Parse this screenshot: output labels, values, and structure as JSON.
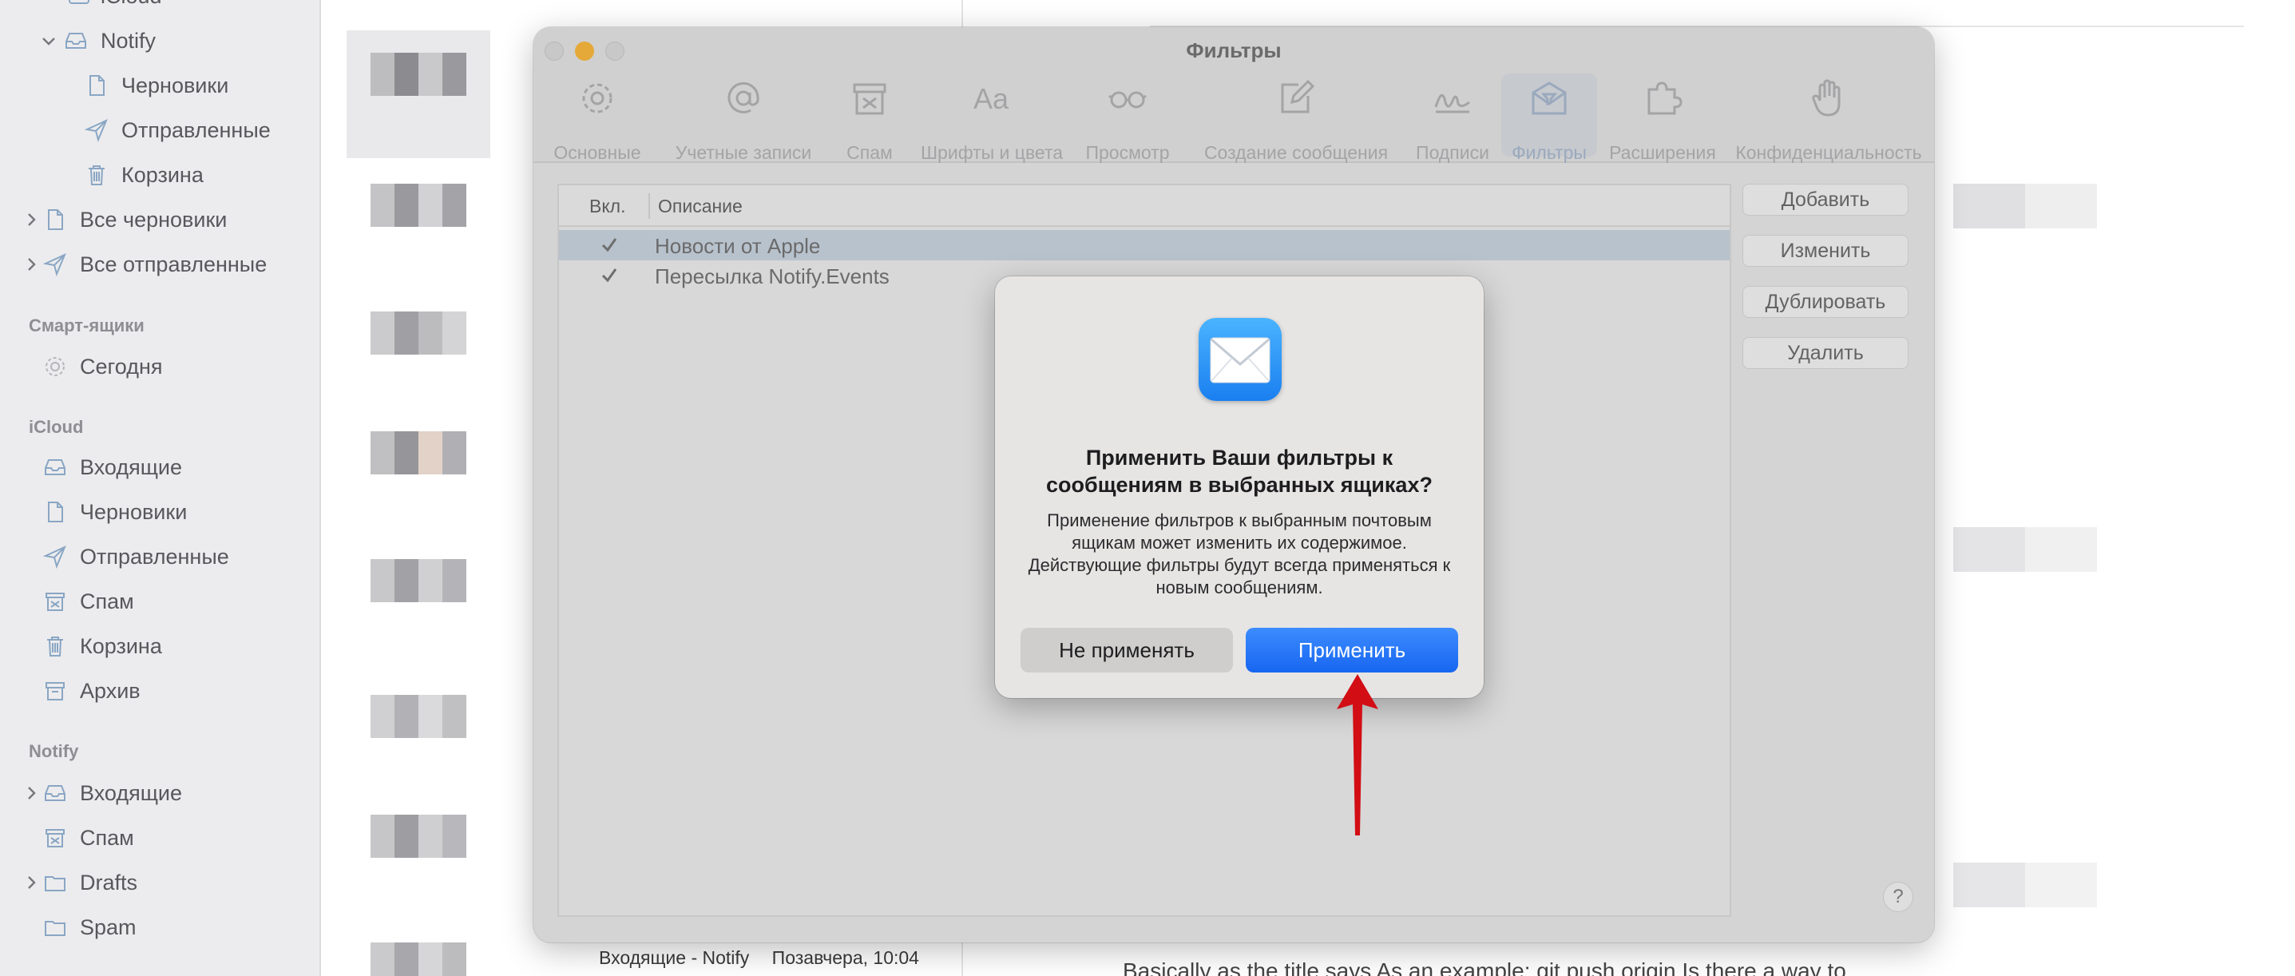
{
  "sidebar": {
    "top_item": {
      "label": "iCloud"
    },
    "notify_account": {
      "label": "Notify"
    },
    "notify_children": [
      {
        "label": "Черновики",
        "icon": "draft-icon"
      },
      {
        "label": "Отправленные",
        "icon": "sent-icon"
      },
      {
        "label": "Корзина",
        "icon": "trash-icon"
      }
    ],
    "all_drafts": {
      "label": "Все черновики"
    },
    "all_sent": {
      "label": "Все отправленные"
    },
    "smart_header": "Смарт-ящики",
    "today": {
      "label": "Сегодня"
    },
    "icloud_header": "iCloud",
    "icloud_items": [
      {
        "label": "Входящие",
        "icon": "inbox-icon"
      },
      {
        "label": "Черновики",
        "icon": "draft-icon"
      },
      {
        "label": "Отправленные",
        "icon": "sent-icon"
      },
      {
        "label": "Спам",
        "icon": "junk-icon"
      },
      {
        "label": "Корзина",
        "icon": "trash-icon"
      },
      {
        "label": "Архив",
        "icon": "archive-icon"
      }
    ],
    "notify_header": "Notify",
    "notify_items": [
      {
        "label": "Входящие",
        "icon": "inbox-icon"
      },
      {
        "label": "Спам",
        "icon": "junk-icon"
      },
      {
        "label": "Drafts",
        "icon": "folder-icon"
      },
      {
        "label": "Spam",
        "icon": "folder-icon"
      }
    ]
  },
  "message_list": {
    "footer_mailbox": "Входящие - Notify",
    "footer_time": "Позавчера, 10:04"
  },
  "reader": {
    "text": "Basically as the title says As an example: git push origin Is there a way to"
  },
  "settings": {
    "title": "Фильтры",
    "toolbar": [
      {
        "label": "Основные",
        "icon": "gear-icon"
      },
      {
        "label": "Учетные записи",
        "icon": "at-icon"
      },
      {
        "label": "Спам",
        "icon": "junk-icon"
      },
      {
        "label": "Шрифты и цвета",
        "icon": "fonts-icon"
      },
      {
        "label": "Просмотр",
        "icon": "glasses-icon"
      },
      {
        "label": "Создание сообщения",
        "icon": "compose-icon"
      },
      {
        "label": "Подписи",
        "icon": "signature-icon"
      },
      {
        "label": "Фильтры",
        "icon": "filter-envelope-icon"
      },
      {
        "label": "Расширения",
        "icon": "puzzle-icon"
      },
      {
        "label": "Конфиденциальность",
        "icon": "hand-icon"
      }
    ],
    "active_tab": "Фильтры",
    "table": {
      "col_enabled": "Вкл.",
      "col_description": "Описание",
      "rows": [
        {
          "enabled": true,
          "description": "Новости от Apple",
          "selected": true
        },
        {
          "enabled": true,
          "description": "Пересылка Notify.Events",
          "selected": false
        }
      ]
    },
    "buttons": {
      "add": "Добавить",
      "edit": "Изменить",
      "duplicate": "Дублировать",
      "remove": "Удалить",
      "help": "?"
    }
  },
  "alert": {
    "icon": "mail-app-icon",
    "title": "Применить Ваши фильтры к сообщениям в выбранных ящиках?",
    "message": "Применение фильтров к выбранным почтовым ящикам может изменить их содержимое. Действующие фильтры будут всегда применяться к новым сообщениям.",
    "cancel_label": "Не применять",
    "confirm_label": "Применить"
  },
  "colors": {
    "accent": "#1a6ef5",
    "annotation_arrow": "#d20d14",
    "mail_icon": "#2b8cf6"
  }
}
